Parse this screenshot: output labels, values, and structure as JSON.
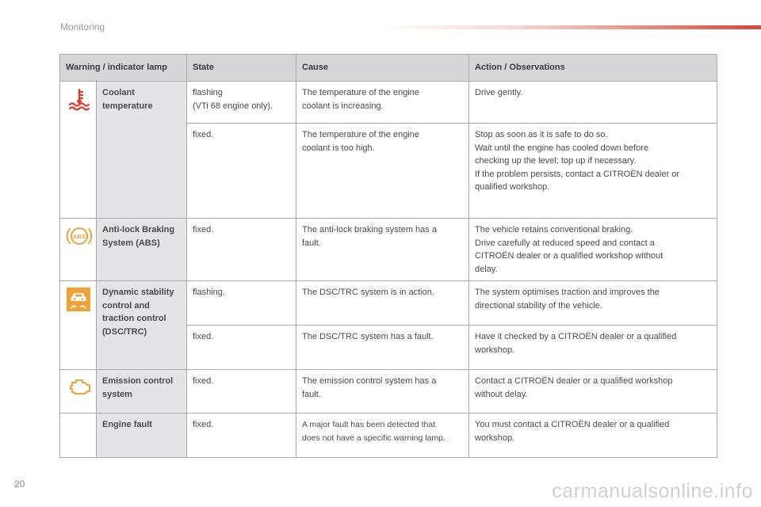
{
  "header": {
    "section": "Monitoring"
  },
  "footer": {
    "page_number": "20",
    "watermark": "carmanualsonline.info"
  },
  "colors": {
    "warning_amber": "#f0a237",
    "header_fill": "#d6d6d8",
    "name_fill": "#e4e4e6"
  },
  "table": {
    "headers": {
      "lamp": "Warning / indicator lamp",
      "state": "State",
      "cause": "Cause",
      "action": "Action / Observations"
    },
    "lamps": [
      {
        "name": "Coolant temperature",
        "icon": "coolant-temperature-icon",
        "rows": [
          {
            "state": "flashing\n(VTi 68 engine only).",
            "cause": "The temperature of the engine\ncoolant is increasing.",
            "action": "Drive gently."
          },
          {
            "state": "fixed.",
            "cause": "The temperature of the engine\ncoolant is too high.",
            "action": "Stop as soon as it is safe to do so.\nWait until the engine has cooled down before\nchecking up the level; top up if necessary.\nIf the problem persists, contact a CITROËN dealer or\nqualified workshop."
          }
        ]
      },
      {
        "name": "Anti-lock Braking System (ABS)",
        "icon": "abs-icon",
        "rows": [
          {
            "state": "fixed.",
            "cause": "The anti-lock braking system has a\nfault.",
            "action": "The vehicle retains conventional braking.\nDrive carefully at reduced speed and contact a\nCITROËN dealer or a qualified workshop without\ndelay."
          }
        ]
      },
      {
        "name": "Dynamic stability control and traction control (DSC/TRC)",
        "icon": "dsc-trc-icon",
        "rows": [
          {
            "state": "flashing.",
            "cause": "The DSC/TRC system is in action.",
            "action": "The system optimises traction and improves the\ndirectional stability of the vehicle."
          },
          {
            "state": "fixed.",
            "cause": "The DSC/TRC system has a fault.",
            "action": "Have it checked by a CITROËN dealer or a qualified\nworkshop."
          }
        ]
      },
      {
        "name": "Emission control system",
        "icon": "engine-icon",
        "rows": [
          {
            "state": "fixed.",
            "cause": "The emission control system has a\nfault.",
            "action": "Contact a CITROËN dealer or a qualified workshop\nwithout delay."
          }
        ]
      },
      {
        "name": "Engine fault",
        "icon": "",
        "rows": [
          {
            "state": "fixed.",
            "cause": "A major fault has been detected that\ndoes not have a specific warning lamp.",
            "action": "You must contact a CITROËN dealer or a qualified\nworkshop."
          }
        ]
      }
    ]
  }
}
